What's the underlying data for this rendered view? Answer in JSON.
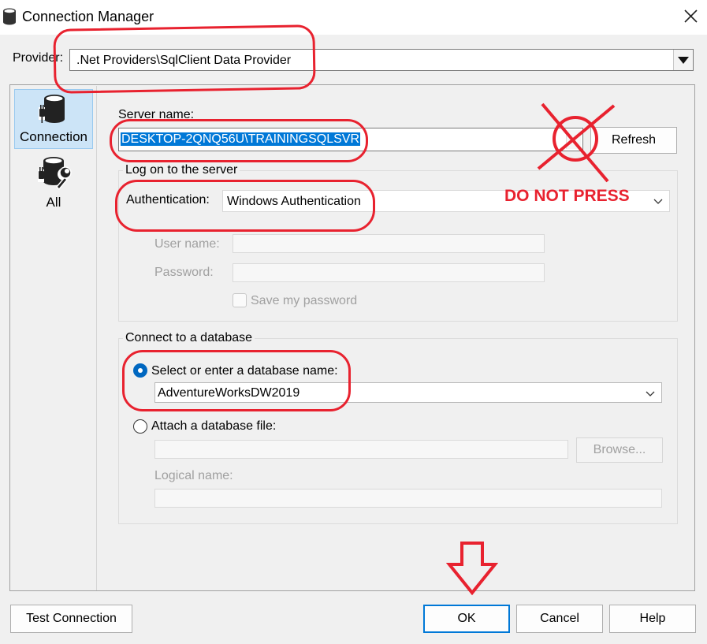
{
  "window": {
    "title": "Connection Manager",
    "close_glyph": "✕"
  },
  "provider": {
    "label": "Provider:",
    "value": ".Net Providers\\SqlClient Data Provider"
  },
  "sidebar": {
    "items": [
      {
        "label": "Connection",
        "icon": "database-plug-icon",
        "selected": true
      },
      {
        "label": "All",
        "icon": "database-wrench-icon",
        "selected": false
      }
    ]
  },
  "server": {
    "label": "Server name:",
    "value": "DESKTOP-2QNQ56U\\TRAININGSQLSVR",
    "refresh_label": "Refresh"
  },
  "logon": {
    "group_title": "Log on to the server",
    "auth_label": "Authentication:",
    "auth_value": "Windows Authentication",
    "username_label": "User name:",
    "username_value": "",
    "password_label": "Password:",
    "password_value": "",
    "save_password_label": "Save my password",
    "save_password_checked": false
  },
  "database": {
    "group_title": "Connect to a database",
    "select_label": "Select or enter a database name:",
    "select_checked": true,
    "db_value": "AdventureWorksDW2019",
    "attach_label": "Attach a database file:",
    "attach_checked": false,
    "attach_value": "",
    "browse_label": "Browse...",
    "logical_label": "Logical name:",
    "logical_value": ""
  },
  "footer": {
    "test_label": "Test Connection",
    "ok_label": "OK",
    "cancel_label": "Cancel",
    "help_label": "Help"
  },
  "annotation": {
    "warning_text": "DO NOT PRESS",
    "color": "#e8222f"
  },
  "colors": {
    "accent": "#0078d7",
    "window_bg": "#f0f0f0",
    "selected_nav_bg": "#cce4f7"
  }
}
